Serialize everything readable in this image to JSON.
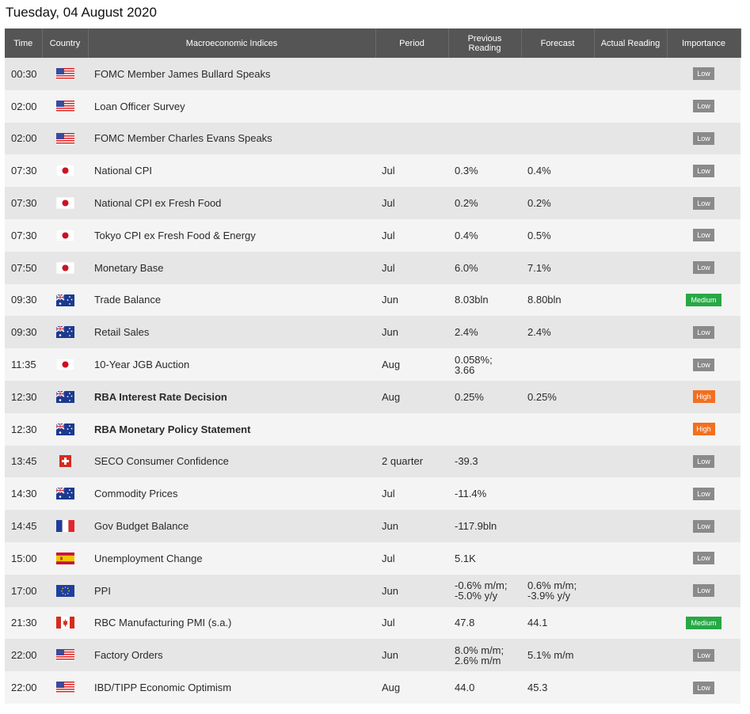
{
  "date_title": "Tuesday, 04 August 2020",
  "headers": {
    "time": "Time",
    "country": "Country",
    "indices": "Macroeconomic Indices",
    "period": "Period",
    "previous": "Previous\nReading",
    "forecast": "Forecast",
    "actual": "Actual Reading",
    "importance": "Importance"
  },
  "importance_colors": {
    "Low": "#8a8a8a",
    "Medium": "#27a844",
    "High": "#f36f21"
  },
  "rows": [
    {
      "time": "00:30",
      "flag": "us-flag-icon",
      "event": "FOMC Member James Bullard Speaks",
      "period": "",
      "previous": "",
      "forecast": "",
      "actual": "",
      "importance": "Low",
      "bold": false
    },
    {
      "time": "02:00",
      "flag": "us-flag-icon",
      "event": "Loan Officer Survey",
      "period": "",
      "previous": "",
      "forecast": "",
      "actual": "",
      "importance": "Low",
      "bold": false
    },
    {
      "time": "02:00",
      "flag": "us-flag-icon",
      "event": "FOMC Member Charles Evans Speaks",
      "period": "",
      "previous": "",
      "forecast": "",
      "actual": "",
      "importance": "Low",
      "bold": false
    },
    {
      "time": "07:30",
      "flag": "jp-flag-icon",
      "event": "National CPI",
      "period": "Jul",
      "previous": "0.3%",
      "forecast": "0.4%",
      "actual": "",
      "importance": "Low",
      "bold": false
    },
    {
      "time": "07:30",
      "flag": "jp-flag-icon",
      "event": "National CPI ex Fresh Food",
      "period": "Jul",
      "previous": "0.2%",
      "forecast": "0.2%",
      "actual": "",
      "importance": "Low",
      "bold": false
    },
    {
      "time": "07:30",
      "flag": "jp-flag-icon",
      "event": "Tokyo CPI ex Fresh Food & Energy",
      "period": "Jul",
      "previous": "0.4%",
      "forecast": "0.5%",
      "actual": "",
      "importance": "Low",
      "bold": false
    },
    {
      "time": "07:50",
      "flag": "jp-flag-icon",
      "event": "Monetary Base",
      "period": "Jul",
      "previous": "6.0%",
      "forecast": "7.1%",
      "actual": "",
      "importance": "Low",
      "bold": false
    },
    {
      "time": "09:30",
      "flag": "au-flag-icon",
      "event": "Trade Balance",
      "period": "Jun",
      "previous": "8.03bln",
      "forecast": "8.80bln",
      "actual": "",
      "importance": "Medium",
      "bold": false
    },
    {
      "time": "09:30",
      "flag": "au-flag-icon",
      "event": "Retail Sales",
      "period": "Jun",
      "previous": "2.4%",
      "forecast": "2.4%",
      "actual": "",
      "importance": "Low",
      "bold": false
    },
    {
      "time": "11:35",
      "flag": "jp-flag-icon",
      "event": "10-Year JGB Auction",
      "period": "Aug",
      "previous": "0.058%;\n3.66",
      "forecast": "",
      "actual": "",
      "importance": "Low",
      "bold": false
    },
    {
      "time": "12:30",
      "flag": "au-flag-icon",
      "event": "RBA Interest Rate Decision",
      "period": "Aug",
      "previous": "0.25%",
      "forecast": "0.25%",
      "actual": "",
      "importance": "High",
      "bold": true
    },
    {
      "time": "12:30",
      "flag": "au-flag-icon",
      "event": "RBA Monetary Policy Statement",
      "period": "",
      "previous": "",
      "forecast": "",
      "actual": "",
      "importance": "High",
      "bold": true
    },
    {
      "time": "13:45",
      "flag": "ch-flag-icon",
      "event": "SECO Consumer Confidence",
      "period": "2 quarter",
      "previous": "-39.3",
      "forecast": "",
      "actual": "",
      "importance": "Low",
      "bold": false
    },
    {
      "time": "14:30",
      "flag": "au-flag-icon",
      "event": "Commodity Prices",
      "period": "Jul",
      "previous": "-11.4%",
      "forecast": "",
      "actual": "",
      "importance": "Low",
      "bold": false
    },
    {
      "time": "14:45",
      "flag": "fr-flag-icon",
      "event": "Gov Budget Balance",
      "period": "Jun",
      "previous": "-117.9bln",
      "forecast": "",
      "actual": "",
      "importance": "Low",
      "bold": false
    },
    {
      "time": "15:00",
      "flag": "es-flag-icon",
      "event": "Unemployment Change",
      "period": "Jul",
      "previous": "5.1K",
      "forecast": "",
      "actual": "",
      "importance": "Low",
      "bold": false
    },
    {
      "time": "17:00",
      "flag": "eu-flag-icon",
      "event": "PPI",
      "period": "Jun",
      "previous": "-0.6% m/m;\n-5.0% y/y",
      "forecast": "0.6% m/m;\n-3.9% y/y",
      "actual": "",
      "importance": "Low",
      "bold": false
    },
    {
      "time": "21:30",
      "flag": "ca-flag-icon",
      "event": "RBC Manufacturing PMI (s.a.)",
      "period": "Jul",
      "previous": "47.8",
      "forecast": "44.1",
      "actual": "",
      "importance": "Medium",
      "bold": false
    },
    {
      "time": "22:00",
      "flag": "us-flag-icon",
      "event": "Factory Orders",
      "period": "Jun",
      "previous": "8.0% m/m;\n2.6% m/m",
      "forecast": "5.1% m/m",
      "actual": "",
      "importance": "Low",
      "bold": false
    },
    {
      "time": "22:00",
      "flag": "us-flag-icon",
      "event": "IBD/TIPP Economic Optimism",
      "period": "Aug",
      "previous": "44.0",
      "forecast": "45.3",
      "actual": "",
      "importance": "Low",
      "bold": false
    }
  ]
}
